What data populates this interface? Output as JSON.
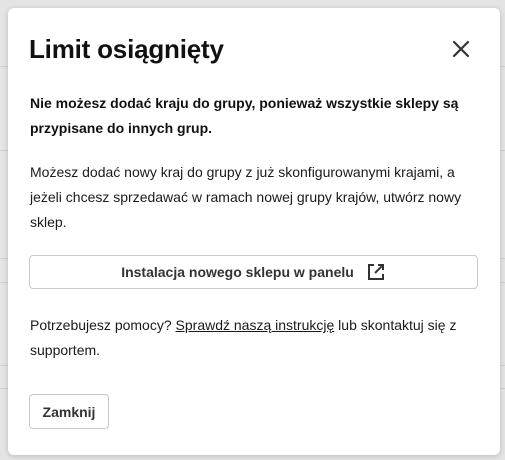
{
  "dialog": {
    "title": "Limit osiągnięty",
    "lead": "Nie możesz dodać kraju do grupy, ponieważ wszystkie sklepy są przypisane do innych grup.",
    "body": "Możesz dodać nowy kraj do grupy z już skonfigurowanymi krajami, a jeżeli chcesz sprzedawać w ramach nowej grupy krajów, utwórz nowy sklep.",
    "install_button_label": "Instalacja nowego sklepu w panelu",
    "help_prefix": "Potrzebujesz pomocy? ",
    "help_link": "Sprawdź naszą instrukcję",
    "help_suffix": " lub skontaktuj się z supportem.",
    "close_button_label": "Zamknij"
  },
  "icons": {
    "close": "close-icon",
    "external_link": "external-link-icon"
  },
  "colors": {
    "backdrop": "#e4e4e4",
    "dialog_background": "#ffffff",
    "text": "#1a1a1a",
    "button_border": "#c9c9c9"
  }
}
